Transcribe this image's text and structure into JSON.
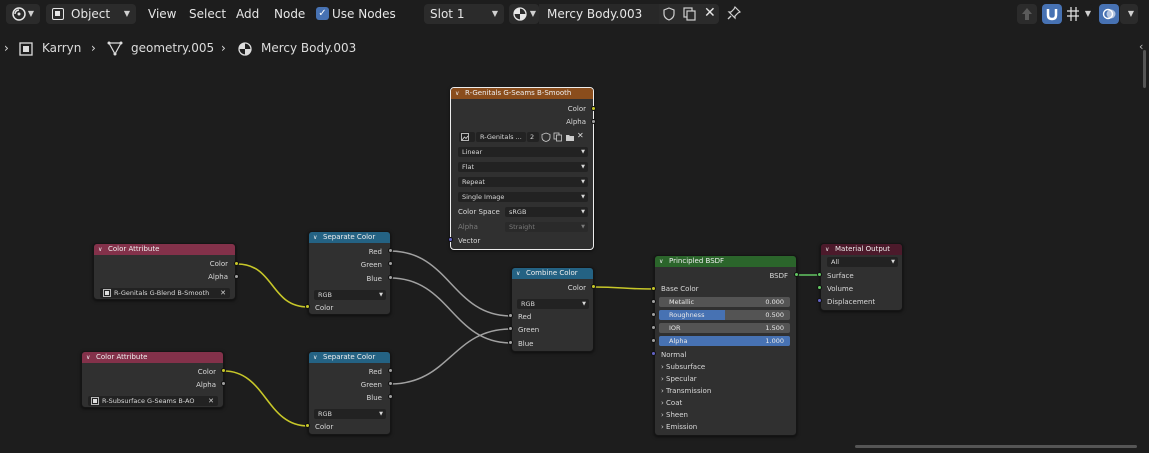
{
  "header": {
    "mode_label": "Object",
    "menu": [
      "View",
      "Select",
      "Add",
      "Node"
    ],
    "use_nodes_label": "Use Nodes",
    "slot_label": "Slot 1",
    "material_name": "Mercy Body.003"
  },
  "breadcrumb": {
    "object": "Karryn",
    "mesh": "geometry.005",
    "material": "Mercy Body.003"
  },
  "nodes": {
    "image_texture": {
      "title": "R-Genitals G-Seams B-Smooth",
      "out_color": "Color",
      "out_alpha": "Alpha",
      "image_name": "R-Genitals ...",
      "users": "2",
      "interpolation": "Linear",
      "projection": "Flat",
      "extension": "Repeat",
      "source": "Single Image",
      "color_space_label": "Color Space",
      "color_space": "sRGB",
      "alpha_label": "Alpha",
      "alpha_mode": "Straight",
      "in_vector": "Vector"
    },
    "color_attr_1": {
      "title": "Color Attribute",
      "out_color": "Color",
      "out_alpha": "Alpha",
      "layer": "R-Genitals G-Blend B-Smooth"
    },
    "color_attr_2": {
      "title": "Color Attribute",
      "out_color": "Color",
      "out_alpha": "Alpha",
      "layer": "R-Subsurface G-Seams B-AO"
    },
    "separate_1": {
      "title": "Separate Color",
      "out_red": "Red",
      "out_green": "Green",
      "out_blue": "Blue",
      "mode": "RGB",
      "in_color": "Color"
    },
    "separate_2": {
      "title": "Separate Color",
      "out_red": "Red",
      "out_green": "Green",
      "out_blue": "Blue",
      "mode": "RGB",
      "in_color": "Color"
    },
    "combine": {
      "title": "Combine Color",
      "out_color": "Color",
      "mode": "RGB",
      "in_red": "Red",
      "in_green": "Green",
      "in_blue": "Blue"
    },
    "bsdf": {
      "title": "Principled BSDF",
      "out_bsdf": "BSDF",
      "base_color": "Base Color",
      "metallic_label": "Metallic",
      "metallic": "0.000",
      "metallic_frac": 0,
      "roughness_label": "Roughness",
      "roughness": "0.500",
      "roughness_frac": 0.5,
      "ior_label": "IOR",
      "ior": "1.500",
      "ior_frac": 0,
      "alpha_label": "Alpha",
      "alpha": "1.000",
      "alpha_frac": 1,
      "normal": "Normal",
      "panels": [
        "Subsurface",
        "Specular",
        "Transmission",
        "Coat",
        "Sheen",
        "Emission"
      ]
    },
    "output": {
      "title": "Material Output",
      "target": "All",
      "in_surface": "Surface",
      "in_volume": "Volume",
      "in_displacement": "Displacement"
    }
  },
  "colors": {
    "texture_header": "#8a4d1c",
    "attribute_header": "#83314a",
    "converter_header": "#246283",
    "shader_header": "#2b652b",
    "output_header": "#4c1a2b",
    "accent": "#4772b3"
  },
  "icons": [
    "editor-type-icon",
    "object-mode-icon",
    "material-sphere-icon",
    "fake-user-shield-icon",
    "duplicate-icon",
    "close-icon",
    "pin-icon",
    "parent-up-icon",
    "snap-magnet-icon",
    "overlay-icon",
    "image-icon",
    "mesh-icon",
    "object-icon"
  ]
}
